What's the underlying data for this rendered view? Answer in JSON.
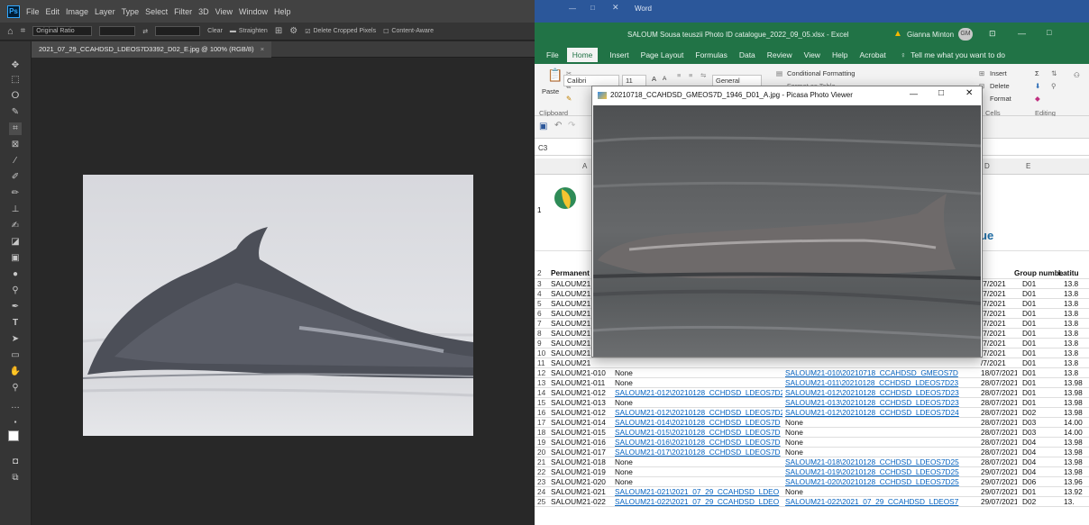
{
  "photoshop": {
    "menu": [
      "File",
      "Edit",
      "Image",
      "Layer",
      "Type",
      "Select",
      "Filter",
      "3D",
      "View",
      "Window",
      "Help"
    ],
    "options": {
      "ratio": "Original Ratio",
      "clear": "Clear",
      "straighten": "Straighten",
      "delete_cropped": "Delete Cropped Pixels",
      "content_aware": "Content-Aware"
    },
    "document_tab": "2021_07_29_CCAHDSD_LDEOS7D3392_D02_E.jpg @ 100% (RGB/8)"
  },
  "word": {
    "title": "Word"
  },
  "excel": {
    "title": "SALOUM Sousa teuszii Photo ID catalogue_2022_09_05.xlsx  -  Excel",
    "user": "Gianna Minton",
    "user_initials": "GM",
    "tabs": [
      "File",
      "Home",
      "Insert",
      "Page Layout",
      "Formulas",
      "Data",
      "Review",
      "View",
      "Help",
      "Acrobat"
    ],
    "tell_me": "Tell me what you want to do",
    "ribbon": {
      "paste": "Paste",
      "clipboard": "Clipboard",
      "font_name": "Calibri",
      "font_size": "11",
      "number_format": "General",
      "conditional": "Conditional Formatting",
      "format_table": "Format as Table",
      "insert": "Insert",
      "delete": "Delete",
      "format": "Format",
      "cells": "Cells",
      "editing": "Editing"
    },
    "name_box": "C3",
    "col_headers": [
      "A",
      "D",
      "E"
    ],
    "row1_text": "ue",
    "header_row": {
      "num": "2",
      "a": "Permanent",
      "e": "Group numbe",
      "f": "Latitu"
    },
    "rows": [
      {
        "n": "3",
        "a": "SALOUM21",
        "d": "/7/2021",
        "e": "D01",
        "f": "13.8"
      },
      {
        "n": "4",
        "a": "SALOUM21",
        "d": "/7/2021",
        "e": "D01",
        "f": "13.8"
      },
      {
        "n": "5",
        "a": "SALOUM21",
        "d": "/7/2021",
        "e": "D01",
        "f": "13.8"
      },
      {
        "n": "6",
        "a": "SALOUM21",
        "d": "/7/2021",
        "e": "D01",
        "f": "13.8"
      },
      {
        "n": "7",
        "a": "SALOUM21",
        "d": "/7/2021",
        "e": "D01",
        "f": "13.8"
      },
      {
        "n": "8",
        "a": "SALOUM21",
        "d": "/7/2021",
        "e": "D01",
        "f": "13.8"
      },
      {
        "n": "9",
        "a": "SALOUM21",
        "d": "/7/2021",
        "e": "D01",
        "f": "13.8"
      },
      {
        "n": "10",
        "a": "SALOUM21",
        "d": "/7/2021",
        "e": "D01",
        "f": "13.8"
      },
      {
        "n": "11",
        "a": "SALOUM21",
        "d": "/7/2021",
        "e": "D01",
        "f": "13.8"
      },
      {
        "n": "12",
        "a": "SALOUM21-010",
        "b": "None",
        "c": "SALOUM21-010\\20210718_CCAHDSD_GMEOS7D",
        "d": "18/07/2021",
        "e": "D01",
        "f": "13.8"
      },
      {
        "n": "13",
        "a": "SALOUM21-011",
        "b": "None",
        "c": "SALOUM21-011\\20210128_CCHDSD_LDEOS7D23",
        "d": "28/07/2021",
        "e": "D01",
        "f": "13.98"
      },
      {
        "n": "14",
        "a": "SALOUM21-012",
        "b": "SALOUM21-012\\20210128_CCHDSD_LDEOS7D2",
        "c": "SALOUM21-012\\20210128_CCHDSD_LDEOS7D23",
        "d": "28/07/2021",
        "e": "D01",
        "f": "13.98"
      },
      {
        "n": "15",
        "a": "SALOUM21-013",
        "b": "None",
        "c": "SALOUM21-013\\20210128_CCHDSD_LDEOS7D23",
        "d": "28/07/2021",
        "e": "D01",
        "f": "13.98"
      },
      {
        "n": "16",
        "a": "SALOUM21-012",
        "b": "SALOUM21-012\\20210128_CCHDSD_LDEOS7D2",
        "c": "SALOUM21-012\\20210128_CCHDSD_LDEOS7D24",
        "d": "28/07/2021",
        "e": "D02",
        "f": "13.98"
      },
      {
        "n": "17",
        "a": "SALOUM21-014",
        "b": "SALOUM21-014\\20210128_CCHDSD_LDEOS7D",
        "c": "None",
        "d": "28/07/2021",
        "e": "D03",
        "f": "14.00"
      },
      {
        "n": "18",
        "a": "SALOUM21-015",
        "b": "SALOUM21-015\\20210128_CCHDSD_LDEOS7D",
        "c": "None",
        "d": "28/07/2021",
        "e": "D03",
        "f": "14.00"
      },
      {
        "n": "19",
        "a": "SALOUM21-016",
        "b": "SALOUM21-016\\20210128_CCHDSD_LDEOS7D",
        "c": "None",
        "d": "28/07/2021",
        "e": "D04",
        "f": "13.98"
      },
      {
        "n": "20",
        "a": "SALOUM21-017",
        "b": "SALOUM21-017\\20210128_CCHDSD_LDEOS7D",
        "c": "None",
        "d": "28/07/2021",
        "e": "D04",
        "f": "13.98"
      },
      {
        "n": "21",
        "a": "SALOUM21-018",
        "b": "None",
        "c": "SALOUM21-018\\20210128_CCHDSD_LDEOS7D25",
        "d": "28/07/2021",
        "e": "D04",
        "f": "13.98"
      },
      {
        "n": "22",
        "a": "SALOUM21-019",
        "b": "None",
        "c": "SALOUM21-019\\20210128_CCHDSD_LDEOS7D25",
        "d": "29/07/2021",
        "e": "D04",
        "f": "13.98"
      },
      {
        "n": "23",
        "a": "SALOUM21-020",
        "b": "None",
        "c": "SALOUM21-020\\20210128_CCHDSD_LDEOS7D25",
        "d": "29/07/2021",
        "e": "D06",
        "f": "13.96"
      },
      {
        "n": "24",
        "a": "SALOUM21-021",
        "b": "SALOUM21-021\\2021_07_29_CCAHDSD_LDEO",
        "c": "None",
        "d": "29/07/2021",
        "e": "D01",
        "f": "13.92"
      },
      {
        "n": "25",
        "a": "SALOUM21-022",
        "b": "SALOUM21-022\\2021_07_29_CCAHDSD_LDEO",
        "c": "SALOUM21-022\\2021_07_29_CCAHDSD_LDEOS7",
        "d": "29/07/2021",
        "e": "D02",
        "f": "13."
      }
    ]
  },
  "picasa": {
    "title": "20210718_CCAHDSD_GMEOS7D_1946_D01_A.jpg - Picasa Photo Viewer"
  }
}
